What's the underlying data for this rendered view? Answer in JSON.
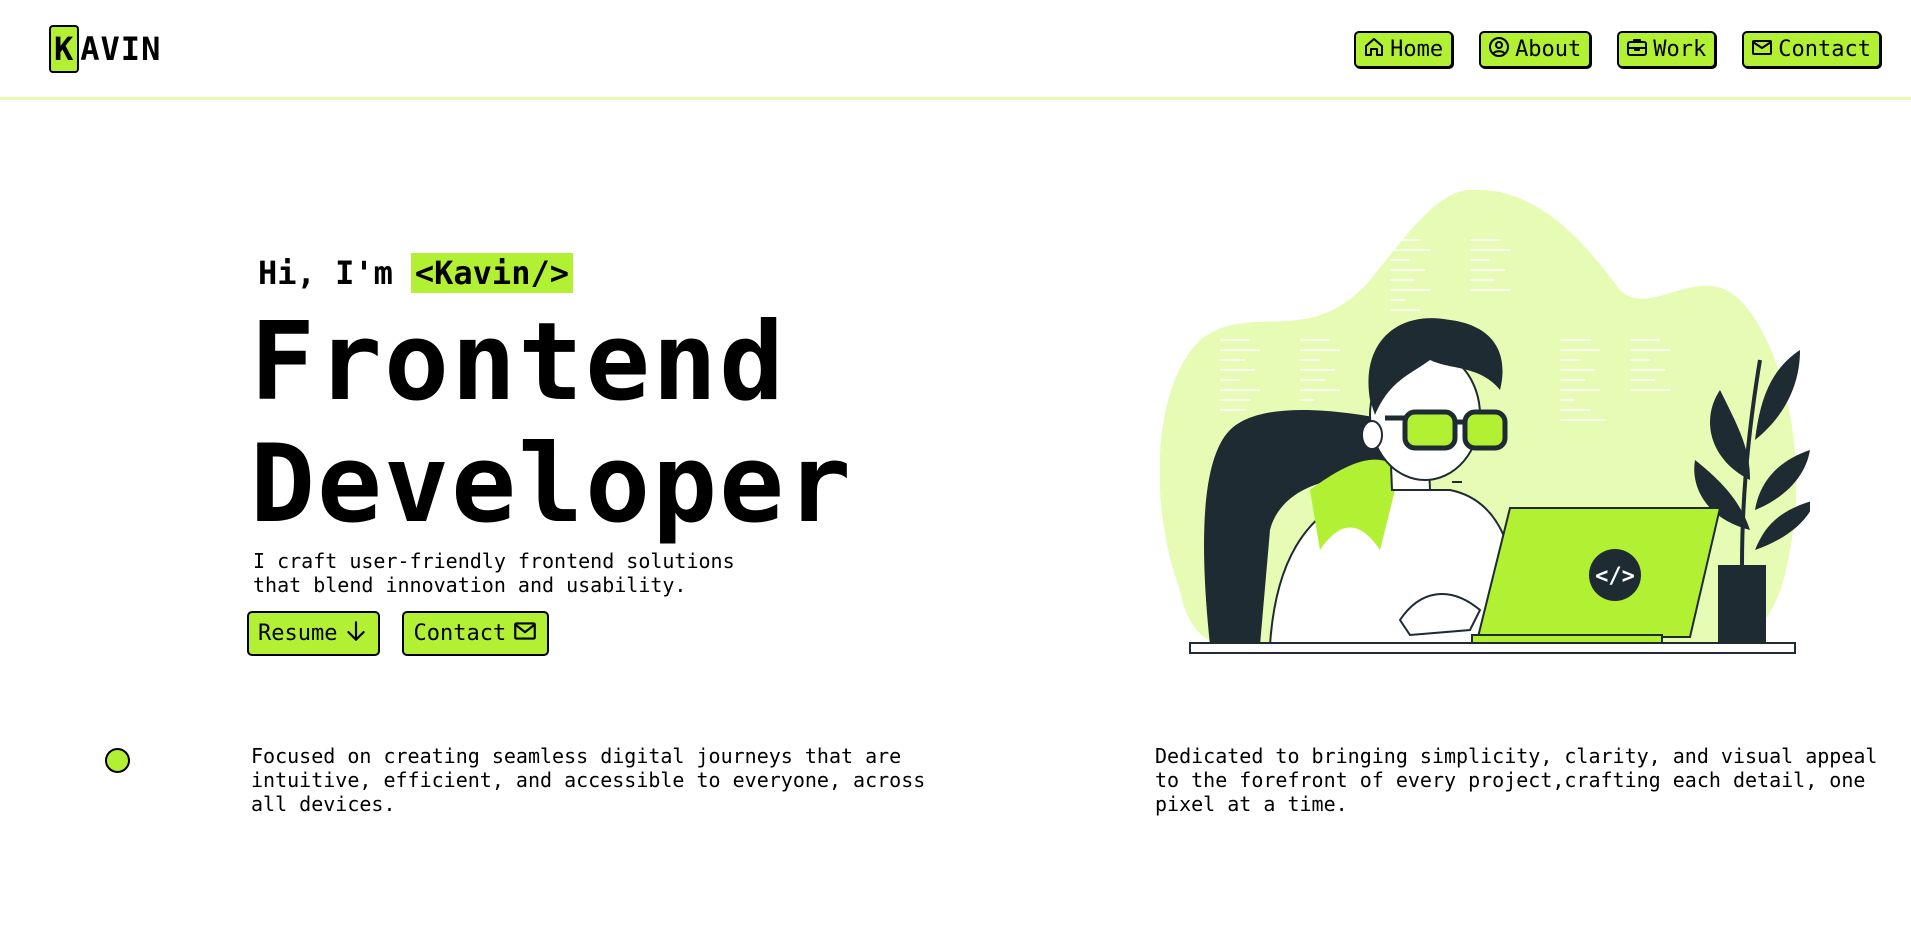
{
  "brand": {
    "logo_initial": "K",
    "logo_rest": "AVIN"
  },
  "nav": {
    "home": {
      "label": "Home",
      "icon": "home-icon"
    },
    "about": {
      "label": "About",
      "icon": "user-circle-icon"
    },
    "work": {
      "label": "Work",
      "icon": "briefcase-icon"
    },
    "contact": {
      "label": "Contact",
      "icon": "mail-icon"
    }
  },
  "hero": {
    "greeting": "Hi, I'm",
    "name_tag": "<Kavin/>",
    "title_line1": "Frontend",
    "title_line2": "Developer",
    "tagline_line1": "I craft user-friendly frontend solutions",
    "tagline_line2": "that blend innovation and usability.",
    "resume_label": "Resume",
    "contact_label": "Contact",
    "laptop_badge": "</>"
  },
  "features": {
    "left": "Focused on creating seamless digital journeys that are intuitive, efficient, and accessible to everyone, across all devices.",
    "right": "Dedicated to bringing simplicity, clarity, and visual appeal to the forefront of every project,crafting each detail, one pixel at a time."
  },
  "colors": {
    "accent": "#b1f033",
    "accent_light": "#e6fbb4",
    "ink": "#1e2b33"
  }
}
